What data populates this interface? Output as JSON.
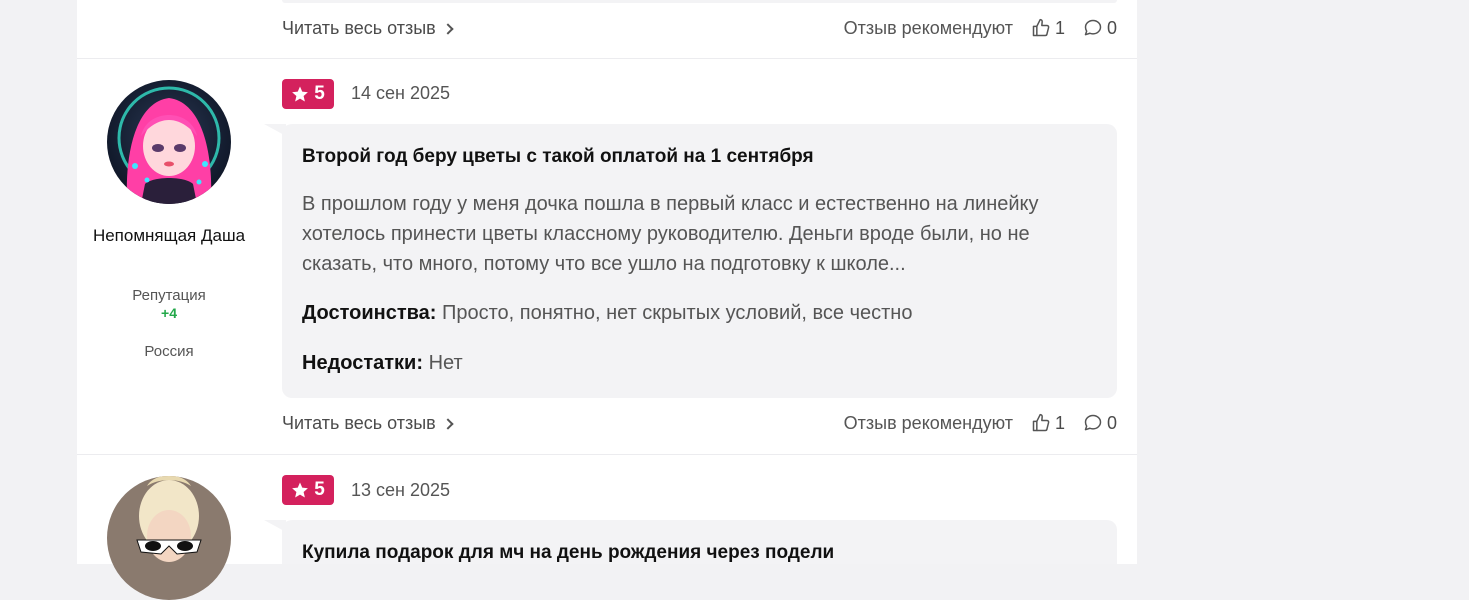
{
  "colors": {
    "rating_badge": "#d4215d",
    "reputation_positive": "#23a84a",
    "bubble_bg": "#f3f3f5",
    "page_bg": "#f2f2f4"
  },
  "icons": {
    "rating": "star-icon",
    "read_more": "chevron-right-icon",
    "likes": "thumbs-up-icon",
    "comments": "speech-bubble-icon"
  },
  "prev_review": {
    "read_more": "Читать весь отзыв",
    "recommend_label": "Отзыв рекомендуют",
    "likes": "1",
    "comments": "0"
  },
  "review1": {
    "rating": "5",
    "date": "14 сен 2025",
    "user": {
      "name": "Непомнящая Даша",
      "reputation_label": "Репутация",
      "reputation_value": "+4",
      "country": "Россия"
    },
    "title": "Второй год беру цветы с такой оплатой на 1 сентября",
    "text": "В прошлом году у меня дочка пошла в первый класс и естественно на линейку хотелось принести цветы классному руководителю. Деньги вроде были, но не сказать, что много, потому что все ушло на подготовку к школе...",
    "pros_label": "Достоинства:",
    "pros": "Просто, понятно, нет скрытых условий, все честно",
    "cons_label": "Недостатки:",
    "cons": "Нет",
    "read_more": "Читать весь отзыв",
    "recommend_label": "Отзыв рекомендуют",
    "likes": "1",
    "comments": "0"
  },
  "review2": {
    "rating": "5",
    "date": "13 сен 2025",
    "title": "Купила подарок для мч на день рождения через подели"
  }
}
